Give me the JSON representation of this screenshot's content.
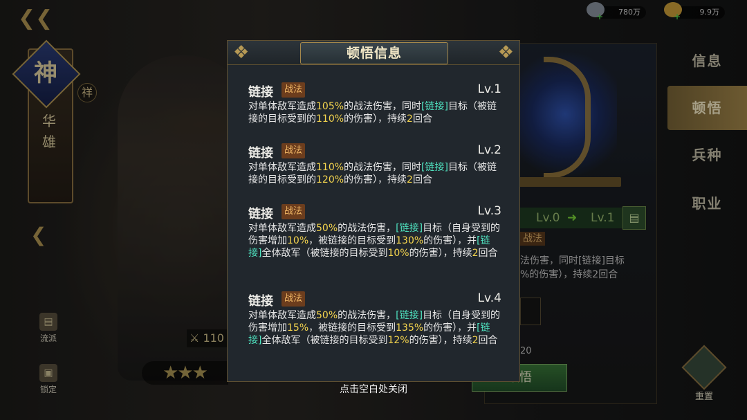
{
  "hero": {
    "badge": "神",
    "name": "华雄",
    "tag": "祥",
    "power_prefix": "110"
  },
  "currency": [
    {
      "name": "silver",
      "amount": "780万"
    },
    {
      "name": "gold",
      "amount": "9.9万"
    }
  ],
  "left_tools": [
    {
      "label": "流派",
      "icon": "book-icon"
    },
    {
      "label": "锁定",
      "icon": "lock-icon"
    }
  ],
  "tabs": [
    {
      "label": "信息",
      "active": false
    },
    {
      "label": "顿悟",
      "active": true
    },
    {
      "label": "兵种",
      "active": false
    },
    {
      "label": "职业",
      "active": false
    }
  ],
  "reset_label": "重置",
  "panel": {
    "lv_from": "Lv.0",
    "lv_to": "Lv.1",
    "tag_peek": "战法",
    "line1_peek": "法伤害，同时[链接]目标",
    "line2_peek": "%的伤害），持续2回合",
    "num_peek": "20",
    "btn_peek": "顿悟"
  },
  "modal": {
    "title": "顿悟信息",
    "entries": [
      {
        "name": "链接",
        "tag": "战法",
        "lv": "Lv.1",
        "desc": [
          [
            "对单体敌军造成",
            ""
          ],
          [
            "105%",
            "y"
          ],
          [
            "的战法伤害，同时",
            ""
          ],
          [
            "[链接]",
            "g"
          ],
          [
            "目标（被链接的目标受到的",
            ""
          ],
          [
            "110%",
            "y"
          ],
          [
            "的伤害），持续",
            ""
          ],
          [
            "2",
            "y"
          ],
          [
            "回合",
            ""
          ]
        ]
      },
      {
        "name": "链接",
        "tag": "战法",
        "lv": "Lv.2",
        "desc": [
          [
            "对单体敌军造成",
            ""
          ],
          [
            "110%",
            "y"
          ],
          [
            "的战法伤害，同时",
            ""
          ],
          [
            "[链接]",
            "g"
          ],
          [
            "目标（被链接的目标受到的",
            ""
          ],
          [
            "120%",
            "y"
          ],
          [
            "的伤害），持续",
            ""
          ],
          [
            "2",
            "y"
          ],
          [
            "回合",
            ""
          ]
        ]
      },
      {
        "name": "链接",
        "tag": "战法",
        "lv": "Lv.3",
        "desc": [
          [
            "对单体敌军造成",
            ""
          ],
          [
            "50%",
            "y"
          ],
          [
            "的战法伤害，",
            ""
          ],
          [
            "[链接]",
            "g"
          ],
          [
            "目标（自身受到的伤害增加",
            ""
          ],
          [
            "10%",
            "y"
          ],
          [
            "，被链接的目标受到",
            ""
          ],
          [
            "130%",
            "y"
          ],
          [
            "的伤害），并",
            ""
          ],
          [
            "[链接]",
            "g"
          ],
          [
            "全体敌军（被链接的目标受到",
            ""
          ],
          [
            "10%",
            "y"
          ],
          [
            "的伤害），持续",
            ""
          ],
          [
            "2",
            "y"
          ],
          [
            "回合",
            ""
          ]
        ]
      },
      {
        "name": "链接",
        "tag": "战法",
        "lv": "Lv.4",
        "desc": [
          [
            "对单体敌军造成",
            ""
          ],
          [
            "50%",
            "y"
          ],
          [
            "的战法伤害，",
            ""
          ],
          [
            "[链接]",
            "g"
          ],
          [
            "目标（自身受到的伤害增加",
            ""
          ],
          [
            "15%",
            "y"
          ],
          [
            "，被链接的目标受到",
            ""
          ],
          [
            "135%",
            "y"
          ],
          [
            "的伤害），并",
            ""
          ],
          [
            "[链接]",
            "g"
          ],
          [
            "全体敌军（被链接的目标受到",
            ""
          ],
          [
            "12%",
            "y"
          ],
          [
            "的伤害），持续",
            ""
          ],
          [
            "2",
            "y"
          ],
          [
            "回合",
            ""
          ]
        ]
      }
    ],
    "close_hint": "点击空白处关闭"
  }
}
